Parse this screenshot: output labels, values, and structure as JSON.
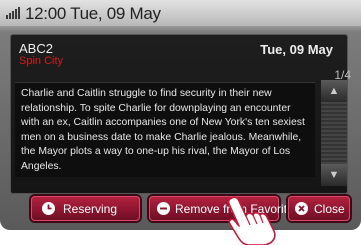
{
  "status": {
    "time_date": "12:00 Tue, 09 May",
    "icon": "signal-icon"
  },
  "info": {
    "channel": "ABC2",
    "program": "Spin City",
    "date": "Tue, 09 May",
    "page": "1/4",
    "description": "Charlie and Caitlin struggle to find security in their new relationship. To spite Charlie for downplaying an encounter with an ex, Caitlin accompanies one of New York's ten sexiest men on a business date to make Charlie jealous. Meanwhile, the Mayor plots a way to one-up his rival, the Mayor of Los Angeles."
  },
  "buttons": {
    "reserving": "Reserving",
    "remove_favorite": "Remove from Favorite",
    "close": "Close"
  },
  "colors": {
    "accent": "#8d1530",
    "program": "#d11c1c"
  }
}
